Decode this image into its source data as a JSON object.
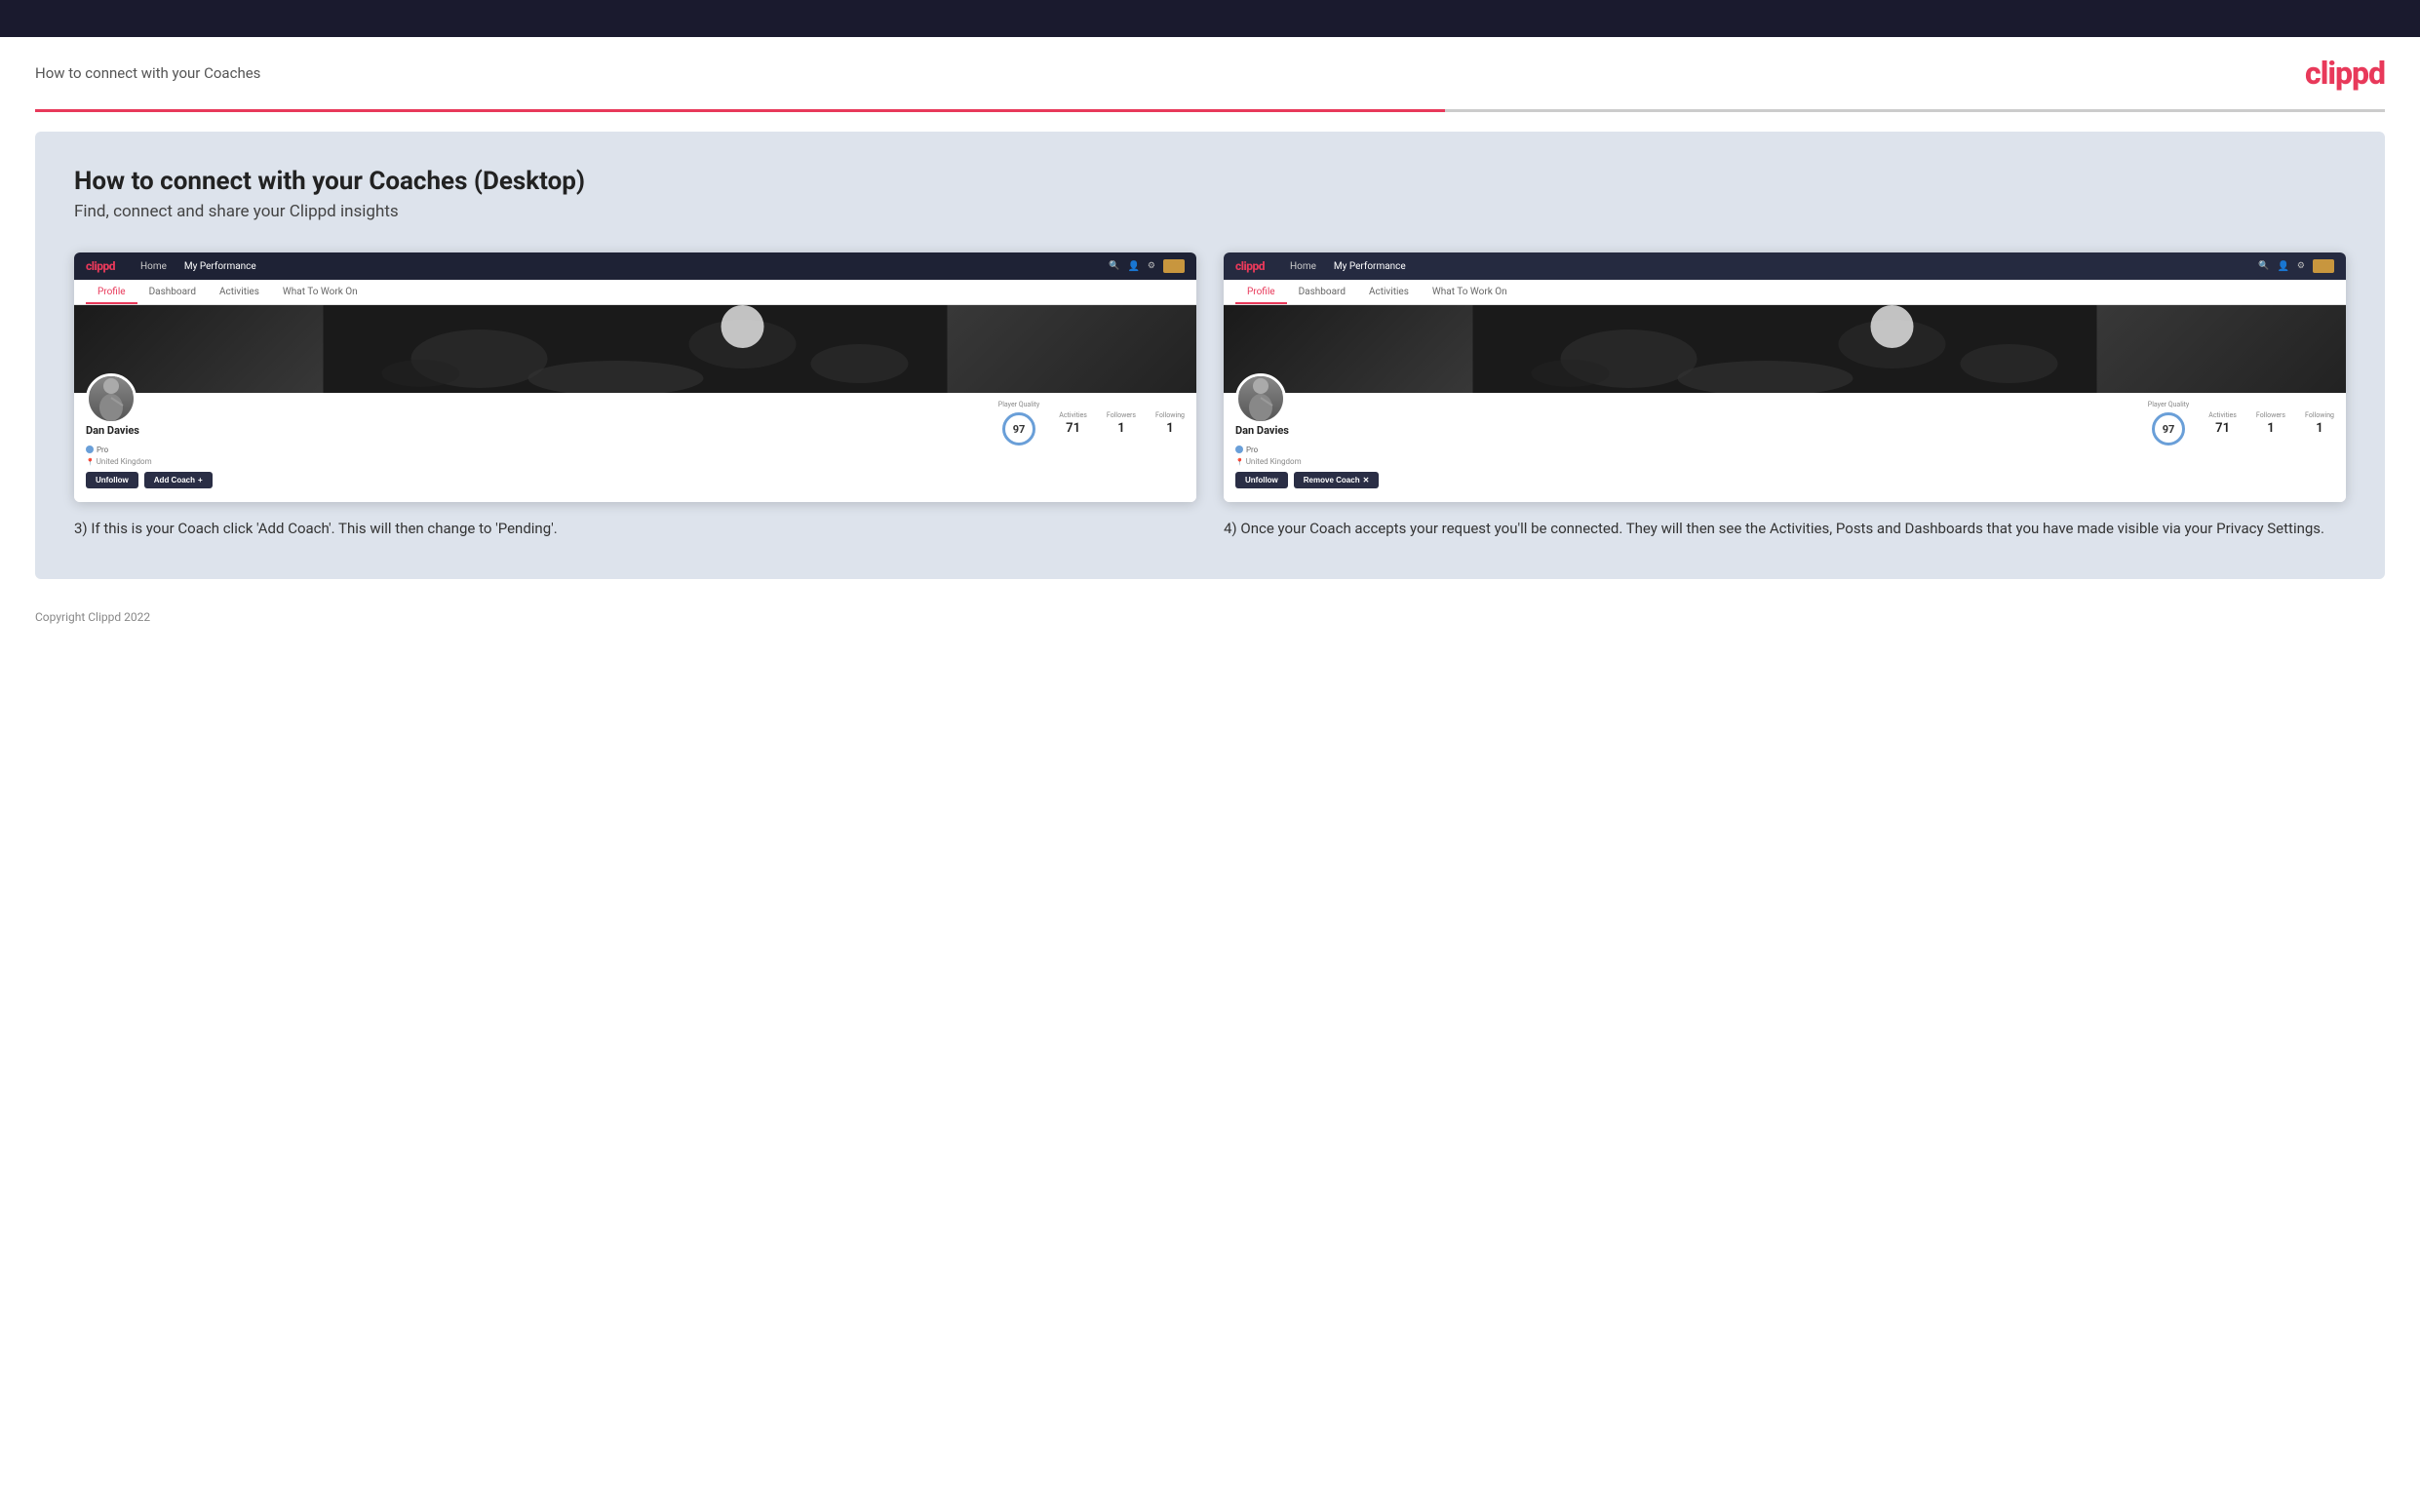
{
  "topbar": {},
  "header": {
    "title": "How to connect with your Coaches",
    "logo": "clippd"
  },
  "main": {
    "heading": "How to connect with your Coaches (Desktop)",
    "subheading": "Find, connect and share your Clippd insights",
    "screenshot1": {
      "nav": {
        "logo": "clippd",
        "links": [
          "Home",
          "My Performance"
        ],
        "tabs": [
          "Profile",
          "Dashboard",
          "Activities",
          "What To Work On"
        ]
      },
      "profile": {
        "name": "Dan Davies",
        "badge": "Pro",
        "location": "United Kingdom",
        "pq_label": "Player Quality",
        "pq_value": "97",
        "stats": [
          {
            "label": "Activities",
            "value": "71"
          },
          {
            "label": "Followers",
            "value": "1"
          },
          {
            "label": "Following",
            "value": "1"
          }
        ],
        "buttons": [
          "Unfollow",
          "Add Coach"
        ]
      },
      "caption": "3) If this is your Coach click 'Add Coach'. This will then change to 'Pending'."
    },
    "screenshot2": {
      "nav": {
        "logo": "clippd",
        "links": [
          "Home",
          "My Performance"
        ],
        "tabs": [
          "Profile",
          "Dashboard",
          "Activities",
          "What To Work On"
        ]
      },
      "profile": {
        "name": "Dan Davies",
        "badge": "Pro",
        "location": "United Kingdom",
        "pq_label": "Player Quality",
        "pq_value": "97",
        "stats": [
          {
            "label": "Activities",
            "value": "71"
          },
          {
            "label": "Followers",
            "value": "1"
          },
          {
            "label": "Following",
            "value": "1"
          }
        ],
        "buttons": [
          "Unfollow",
          "Remove Coach"
        ]
      },
      "caption": "4) Once your Coach accepts your request you'll be connected. They will then see the Activities, Posts and Dashboards that you have made visible via your Privacy Settings."
    }
  },
  "footer": {
    "copyright": "Copyright Clippd 2022"
  }
}
